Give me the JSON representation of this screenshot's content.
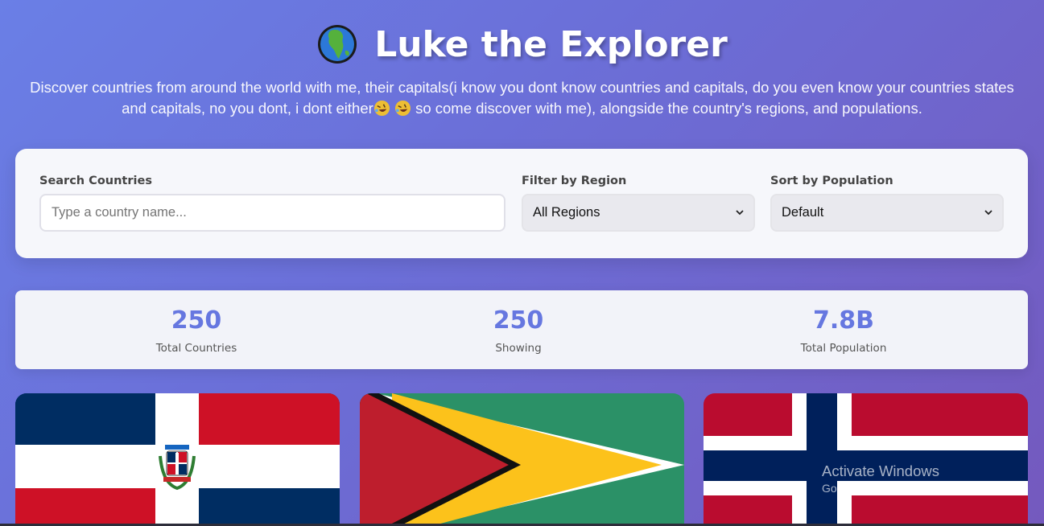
{
  "header": {
    "title": "Luke the Explorer",
    "subtitle_part1": "Discover countries from around the world with me, their capitals(i know you dont know countries and capitals, do you even know your countries states and capitals, no you dont, i dont either",
    "subtitle_part2": " so come discover with me), alongside the country's regions, and populations."
  },
  "controls": {
    "search": {
      "label": "Search Countries",
      "value": "",
      "placeholder": "Type a country name..."
    },
    "region": {
      "label": "Filter by Region",
      "selected": "All Regions"
    },
    "sort": {
      "label": "Sort by Population",
      "selected": "Default"
    }
  },
  "stats": {
    "total": {
      "value": "250",
      "label": "Total Countries"
    },
    "showing": {
      "value": "250",
      "label": "Showing"
    },
    "population": {
      "value": "7.8B",
      "label": "Total Population"
    }
  },
  "cards": [
    {
      "flag": "dominican-republic"
    },
    {
      "flag": "guyana"
    },
    {
      "flag": "norway"
    }
  ],
  "watermark": {
    "line1": "Activate Windows",
    "line2": "Go to Settings to activate Windows."
  },
  "icons": {
    "logo": "globe-icon",
    "emoji": "rolling-laughing-emoji",
    "select_arrow": "chevron-down-icon"
  },
  "colors": {
    "accent": "#6677e0",
    "gradient_start": "#6a7fe6",
    "gradient_end": "#7459be"
  }
}
